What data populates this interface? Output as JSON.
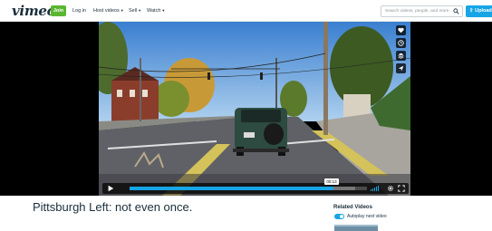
{
  "nav": {
    "logo": "vimeo",
    "join_label": "Join",
    "links": [
      {
        "label": "Log in",
        "dropdown": false
      },
      {
        "label": "Host videos",
        "dropdown": true
      },
      {
        "label": "Sell",
        "dropdown": true
      },
      {
        "label": "Watch",
        "dropdown": true
      }
    ],
    "search_placeholder": "Search videos, people, and more",
    "upload_label": "Upload"
  },
  "player": {
    "time_tooltip": "00:13",
    "progress_fraction": 0.86,
    "loaded_fraction": 0.95,
    "side_actions": [
      "heart-icon",
      "clock-icon",
      "stack-icon",
      "send-icon"
    ],
    "accent_color": "#17a5e6"
  },
  "video": {
    "title": "Pittsburgh Left: not even once."
  },
  "related": {
    "title": "Related Videos",
    "autoplay_label": "Autoplay next video",
    "autoplay_on": true
  },
  "colors": {
    "brand_green": "#5ab630",
    "brand_blue": "#17a5e6",
    "text_dark": "#1a2e3b"
  }
}
